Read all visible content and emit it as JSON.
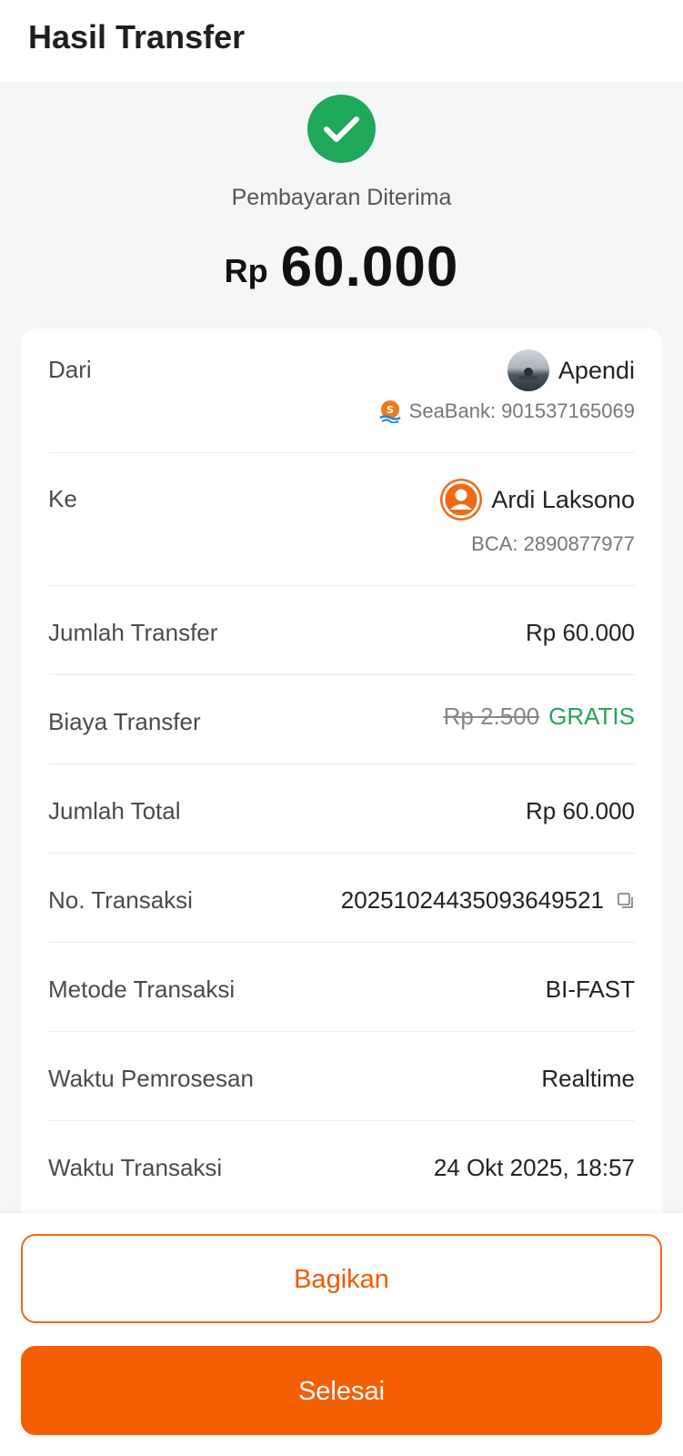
{
  "header": {
    "title": "Hasil Transfer"
  },
  "status": {
    "text": "Pembayaran Diterima",
    "currency": "Rp",
    "amount": "60.000",
    "color": "#1fa85a"
  },
  "from": {
    "label": "Dari",
    "name": "Apendi",
    "account": "SeaBank: 901537165069",
    "icon": "seabank-icon"
  },
  "to": {
    "label": "Ke",
    "name": "Ardi Laksono",
    "account": "BCA: 2890877977",
    "icon": "user-avatar-icon"
  },
  "details": {
    "transfer_amount": {
      "label": "Jumlah Transfer",
      "value": "Rp 60.000"
    },
    "transfer_fee": {
      "label": "Biaya Transfer",
      "original": "Rp 2.500",
      "value": "GRATIS"
    },
    "total": {
      "label": "Jumlah Total",
      "value": "Rp 60.000"
    },
    "transaction_no": {
      "label": "No. Transaksi",
      "value": "20251024435093649521"
    },
    "method": {
      "label": "Metode Transaksi",
      "value": "BI-FAST"
    },
    "processing_time": {
      "label": "Waktu Pemrosesan",
      "value": "Realtime"
    },
    "transaction_time": {
      "label": "Waktu Transaksi",
      "value": "24 Okt 2025, 18:57"
    }
  },
  "actions": {
    "share_label": "Bagikan",
    "done_label": "Selesai",
    "accent": "#f55f04"
  }
}
